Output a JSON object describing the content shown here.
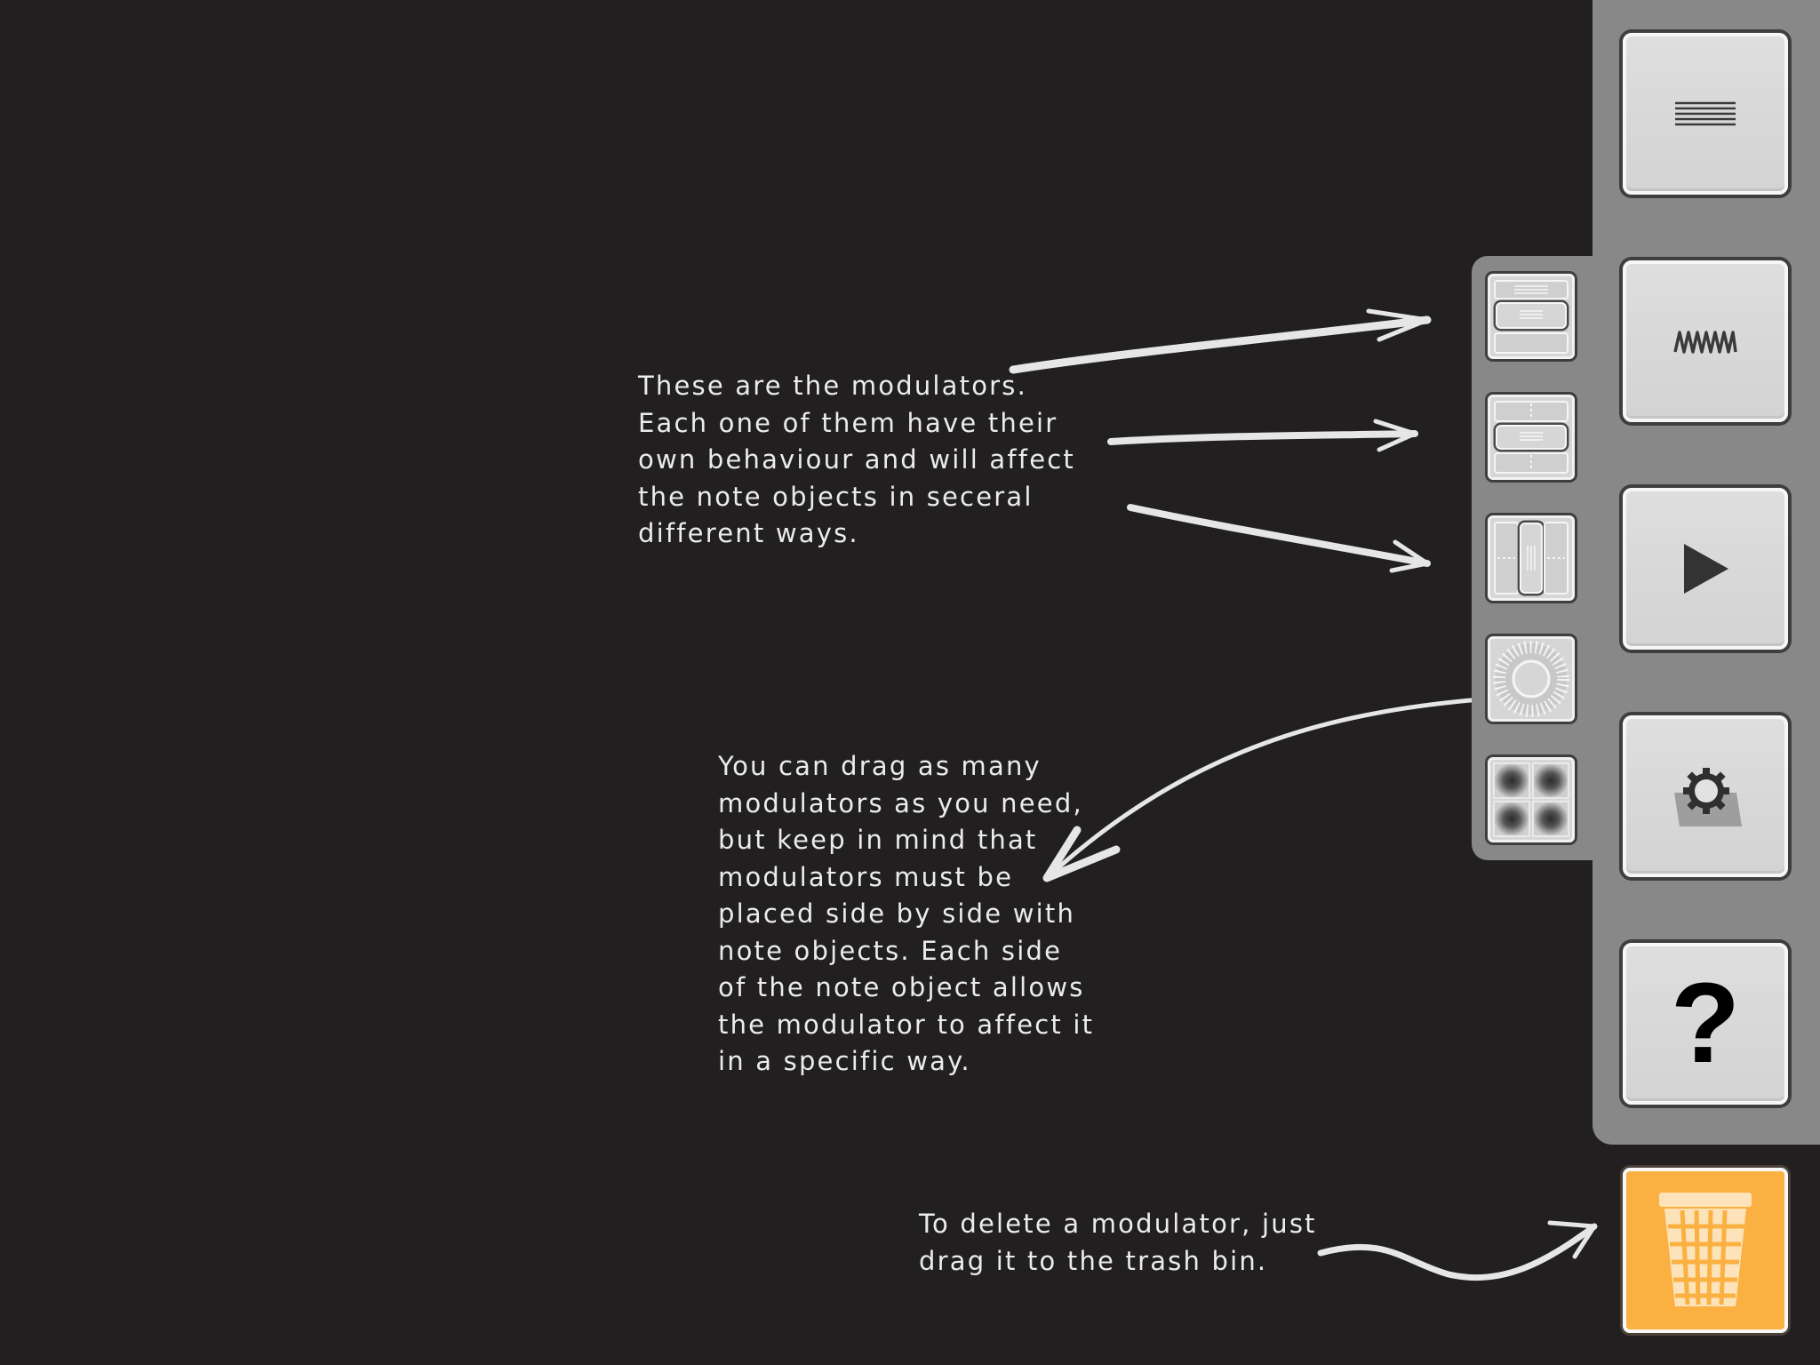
{
  "notes": {
    "modulators": "These are the modulators.\nEach one of them have their\nown behaviour and will affect\nthe note objects in seceral\ndifferent ways.",
    "drag": "You can drag as many\nmodulators as you need,\nbut keep in mind that\nmodulators must be\nplaced side by side with\nnote objects. Each side\nof the note object allows\nthe modulator to affect it\nin a specific way.",
    "trash": "To delete a modulator, just\ndrag it to the trash bin."
  },
  "toolbar": {
    "help_label": "?",
    "items": [
      "lines-icon",
      "wave-icon",
      "play-icon",
      "settings-icon",
      "help-icon"
    ]
  },
  "modulators": [
    "modulator-slider-horizontal-icon",
    "modulator-slider-center-icon",
    "modulator-slider-vertical-icon",
    "modulator-radial-icon",
    "modulator-grid-icon"
  ],
  "trash": {
    "icon": "trash-bin-icon",
    "color": "#fbb042"
  },
  "colors": {
    "background": "#221f20",
    "panel": "#888889",
    "button": "#d6d6d7",
    "accent": "#fbb042"
  }
}
